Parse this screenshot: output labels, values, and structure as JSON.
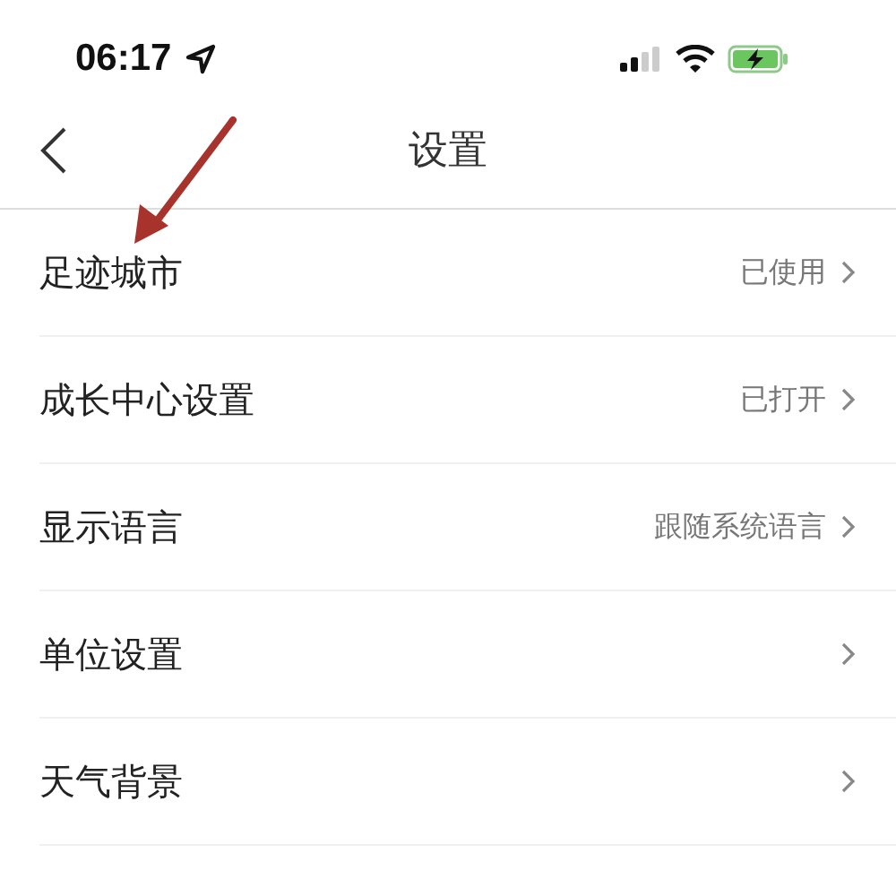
{
  "status_bar": {
    "time": "06:17"
  },
  "nav": {
    "title": "设置"
  },
  "rows": [
    {
      "label": "足迹城市",
      "value": "已使用"
    },
    {
      "label": "成长中心设置",
      "value": "已打开"
    },
    {
      "label": "显示语言",
      "value": "跟随系统语言"
    },
    {
      "label": "单位设置"
    },
    {
      "label": "天气背景"
    }
  ]
}
